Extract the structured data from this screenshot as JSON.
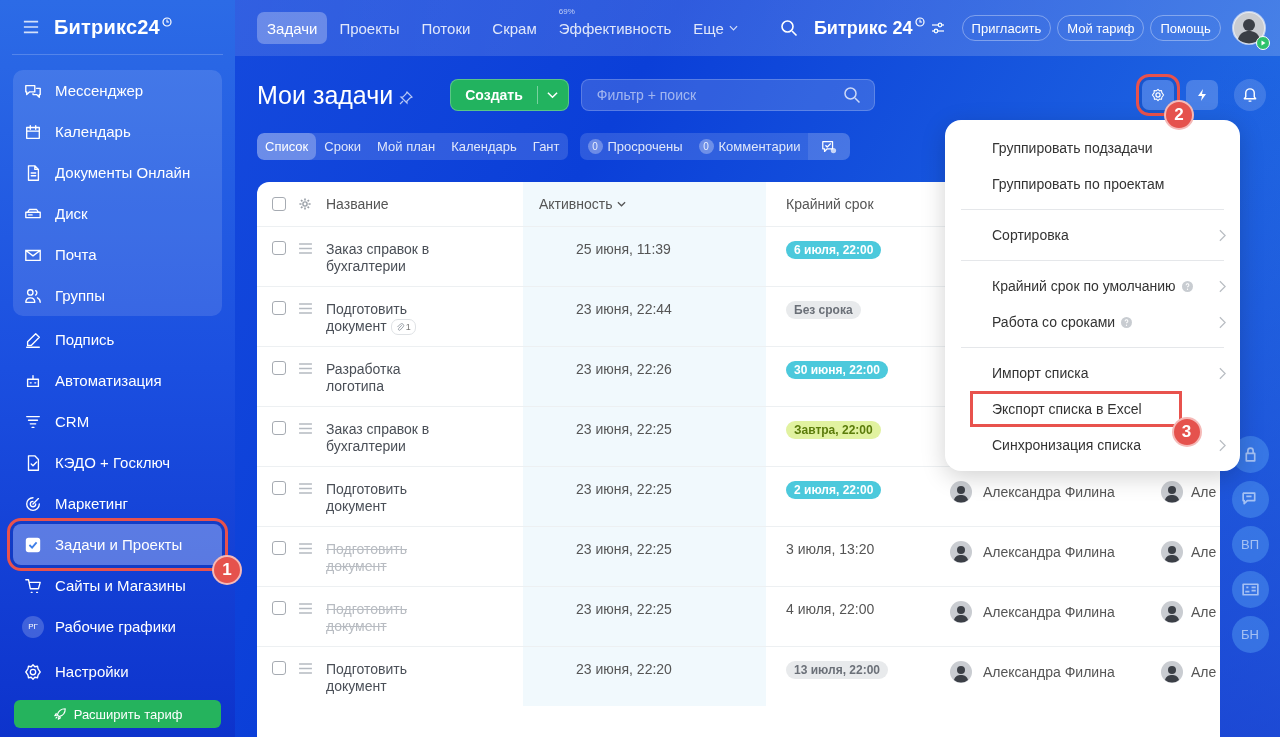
{
  "topbar": {
    "logo": "Битрикс24",
    "nav": [
      {
        "label": "Задачи",
        "selected": true
      },
      {
        "label": "Проекты",
        "selected": false
      },
      {
        "label": "Потоки",
        "selected": false
      },
      {
        "label": "Скрам",
        "selected": false
      },
      {
        "label": "Эффективность",
        "selected": false,
        "badge": "69%"
      },
      {
        "label": "Еще",
        "selected": false,
        "dropdown": true
      }
    ],
    "portal": "Битрикс 24",
    "buttons": [
      "Пригласить",
      "Мой тариф",
      "Помощь"
    ],
    "online": true
  },
  "sidebar": {
    "sections": [
      {
        "panel": true,
        "items": [
          {
            "label": "Мессенджер",
            "selected": false
          },
          {
            "label": "Календарь",
            "selected": false
          },
          {
            "label": "Документы Онлайн",
            "selected": false
          },
          {
            "label": "Диск",
            "selected": false
          },
          {
            "label": "Почта",
            "selected": false
          },
          {
            "label": "Группы",
            "selected": false
          }
        ]
      },
      {
        "panel": false,
        "items": [
          {
            "label": "Подпись",
            "selected": false
          },
          {
            "label": "Автоматизация",
            "selected": false
          },
          {
            "label": "CRM",
            "selected": false
          },
          {
            "label": "КЭДО + Госключ",
            "selected": false
          },
          {
            "label": "Маркетинг",
            "selected": false
          },
          {
            "label": "Задачи и Проекты",
            "selected": true,
            "callout": "1"
          },
          {
            "label": "Сайты и Магазины",
            "selected": false
          },
          {
            "label": "Рабочие графики",
            "selected": false,
            "initials": "РГ"
          }
        ]
      }
    ],
    "settings": "Настройки",
    "upgrade": "Расширить тариф"
  },
  "page": {
    "title": "Мои задачи",
    "create": "Создать",
    "search_placeholder": "Фильтр + поиск",
    "views": [
      {
        "label": "Список",
        "selected": true
      },
      {
        "label": "Сроки",
        "selected": false
      },
      {
        "label": "Мой план",
        "selected": false
      },
      {
        "label": "Календарь",
        "selected": false
      },
      {
        "label": "Гант",
        "selected": false
      }
    ],
    "counters": [
      {
        "count": "0",
        "label": "Просрочены"
      },
      {
        "count": "0",
        "label": "Комментарии"
      }
    ],
    "settings_button": {
      "callout": "2"
    }
  },
  "table": {
    "select_all_checked": false,
    "columns": [
      "Название",
      "Активность",
      "Крайний срок"
    ],
    "rows": [
      {
        "title": "Заказ справок в бухгалтерии",
        "checked": false,
        "completed": false,
        "activity": "25 июня, 11:39",
        "deadline": {
          "text": "6 июля, 22:00",
          "kind": "week"
        }
      },
      {
        "title": "Подготовить документ",
        "checked": false,
        "completed": false,
        "attachments": "1",
        "activity": "23 июня, 22:44",
        "deadline": {
          "text": "Без срока",
          "kind": "empty"
        }
      },
      {
        "title": "Разработка логотипа",
        "checked": false,
        "completed": false,
        "activity": "23 июня, 22:26",
        "deadline": {
          "text": "30 июня, 22:00",
          "kind": "week"
        }
      },
      {
        "title": "Заказ справок в бухгалтерии",
        "checked": false,
        "completed": false,
        "activity": "23 июня, 22:25",
        "deadline": {
          "text": "Завтра, 22:00",
          "kind": "tomorrow"
        }
      },
      {
        "title": "Подготовить документ",
        "checked": false,
        "completed": false,
        "activity": "23 июня, 22:25",
        "deadline": {
          "text": "2 июля, 22:00",
          "kind": "week"
        },
        "responsible": "Александра Филина",
        "column_5": "Але"
      },
      {
        "title": "Подготовить документ",
        "checked": false,
        "completed": true,
        "activity": "23 июня, 22:25",
        "deadline": {
          "text": "3 июля, 13:20",
          "kind": "plain"
        },
        "responsible": "Александра Филина",
        "column_5": "Але"
      },
      {
        "title": "Подготовить документ",
        "checked": false,
        "completed": true,
        "activity": "23 июня, 22:25",
        "deadline": {
          "text": "4 июля, 22:00",
          "kind": "plain"
        },
        "responsible": "Александра Филина",
        "column_5": "Але"
      },
      {
        "title": "Подготовить документ",
        "checked": false,
        "completed": false,
        "activity": "23 июня, 22:20",
        "deadline": {
          "text": "13 июля, 22:00",
          "kind": "later"
        },
        "responsible": "Александра Филина",
        "column_5": "Але"
      }
    ]
  },
  "menu": {
    "sections": [
      [
        {
          "label": "Группировать подзадачи",
          "submenu": false,
          "help": false
        },
        {
          "label": "Группировать по проектам",
          "submenu": false,
          "help": false
        }
      ],
      [
        {
          "label": "Сортировка",
          "submenu": true,
          "help": false
        }
      ],
      [
        {
          "label": "Крайний срок по умолчанию",
          "submenu": true,
          "help": true
        },
        {
          "label": "Работа со сроками",
          "submenu": true,
          "help": true
        }
      ],
      [
        {
          "label": "Импорт списка",
          "submenu": true,
          "help": false
        },
        {
          "label": "Экспорт списка в Excel",
          "submenu": false,
          "help": false,
          "callout": "3"
        },
        {
          "label": "Синхронизация списка",
          "submenu": true,
          "help": false
        }
      ]
    ]
  },
  "right_strip": {
    "items": [
      {
        "kind": "icon"
      },
      {
        "kind": "icon"
      },
      {
        "kind": "initials",
        "text": "ВП"
      },
      {
        "kind": "icon"
      },
      {
        "kind": "initials",
        "text": "БН"
      }
    ]
  }
}
